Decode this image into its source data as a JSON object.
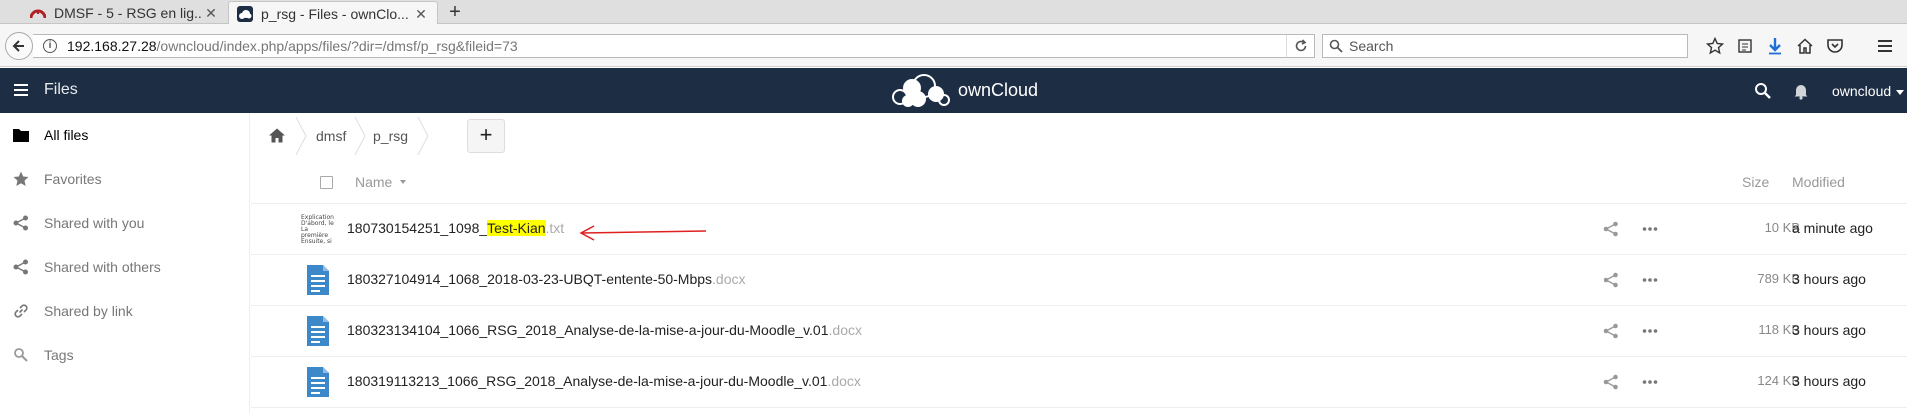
{
  "browser": {
    "tabs": [
      {
        "label": "DMSF - 5 - RSG en lig...",
        "close": "✕"
      },
      {
        "label": "p_rsg - Files - ownClo...",
        "close": "✕"
      }
    ],
    "new_tab": "+",
    "url_host": "192.168.27.28",
    "url_path": "/owncloud/index.php/apps/files/?dir=/dmsf/p_rsg&fileid=73",
    "search_placeholder": "Search"
  },
  "header": {
    "app_title": "Files",
    "brand": "ownCloud",
    "user": "owncloud"
  },
  "sidebar": {
    "items": [
      {
        "label": "All files",
        "icon": "folder-icon",
        "active": true
      },
      {
        "label": "Favorites",
        "icon": "star-icon"
      },
      {
        "label": "Shared with you",
        "icon": "share-icon"
      },
      {
        "label": "Shared with others",
        "icon": "share-icon"
      },
      {
        "label": "Shared by link",
        "icon": "link-icon"
      },
      {
        "label": "Tags",
        "icon": "tag-icon"
      }
    ]
  },
  "breadcrumb": {
    "items": [
      "dmsf",
      "p_rsg"
    ],
    "new_label": "+"
  },
  "table": {
    "headers": {
      "name": "Name",
      "size": "Size",
      "modified": "Modified"
    },
    "rows": [
      {
        "name_prefix": "180730154251_1098_",
        "name_highlight": "Test-Kian",
        "ext": ".txt",
        "size": "10 KB",
        "modified": "a minute ago",
        "preview_lines": [
          "Explication",
          "D'abord, le",
          "La première",
          "Ensuite, si"
        ]
      },
      {
        "name": "180327104914_1068_2018-03-23-UBQT-entente-50-Mbps",
        "ext": ".docx",
        "size": "789 KB",
        "modified": "3 hours ago"
      },
      {
        "name": "180323134104_1066_RSG_2018_Analyse-de-la-mise-a-jour-du-Moodle_v.01",
        "ext": ".docx",
        "size": "118 KB",
        "modified": "3 hours ago"
      },
      {
        "name": "180319113213_1066_RSG_2018_Analyse-de-la-mise-a-jour-du-Moodle_v.01",
        "ext": ".docx",
        "size": "124 KB",
        "modified": "3 hours ago"
      }
    ]
  },
  "colors": {
    "header_bg": "#1d2d44",
    "highlight": "#ffff00",
    "doc_icon": "#3d88c9",
    "annotation": "#e02020"
  }
}
